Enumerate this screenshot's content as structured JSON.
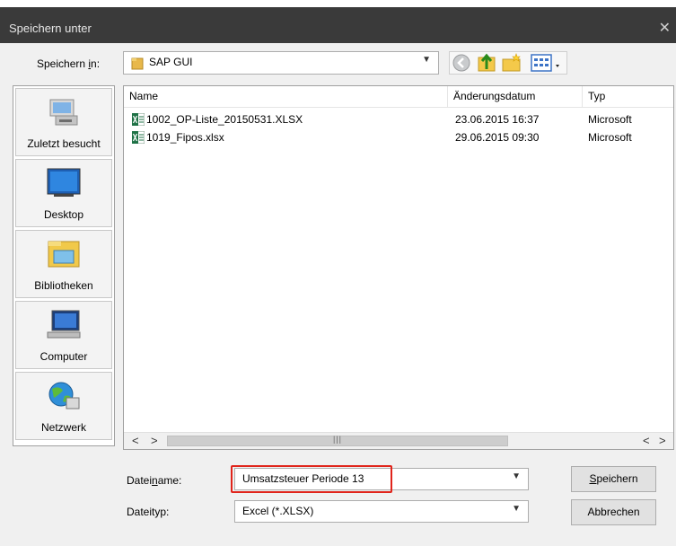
{
  "window": {
    "title": "Speichern unter",
    "close_glyph": "✕"
  },
  "save_in": {
    "label_pre": "Speichern ",
    "label_mnemonic": "i",
    "label_post": "n:",
    "value": "SAP GUI"
  },
  "toolbar": {
    "icons": [
      "back-icon",
      "up-folder-icon",
      "new-folder-icon",
      "view-menu-icon"
    ]
  },
  "places": [
    {
      "label": "Zuletzt besucht",
      "icon": "recent-places-icon"
    },
    {
      "label": "Desktop",
      "icon": "desktop-icon"
    },
    {
      "label": "Bibliotheken",
      "icon": "libraries-icon"
    },
    {
      "label": "Computer",
      "icon": "computer-icon"
    },
    {
      "label": "Netzwerk",
      "icon": "network-icon"
    }
  ],
  "filelist": {
    "columns": [
      "Name",
      "Änderungsdatum",
      "Typ"
    ],
    "rows": [
      {
        "name": "1002_OP-Liste_20150531.XLSX",
        "date": "23.06.2015 16:37",
        "type": "Microsoft"
      },
      {
        "name": "1019_Fipos.xlsx",
        "date": "29.06.2015 09:30",
        "type": "Microsoft"
      }
    ],
    "scroll": {
      "left": "<",
      "right": ">",
      "grip": "|||"
    }
  },
  "filename": {
    "label_pre": "Datei",
    "label_mnemonic": "n",
    "label_post": "ame:",
    "value": "Umsatzsteuer Periode 13"
  },
  "filetype": {
    "label": "Dateityp:",
    "value": "Excel (*.XLSX)"
  },
  "buttons": {
    "save_mnemonic": "S",
    "save_rest": "peichern",
    "cancel": "Abbrechen"
  },
  "colors": {
    "titlebar": "#3a3a3a",
    "highlight": "#e0241b",
    "excel_green": "#1e7145"
  }
}
